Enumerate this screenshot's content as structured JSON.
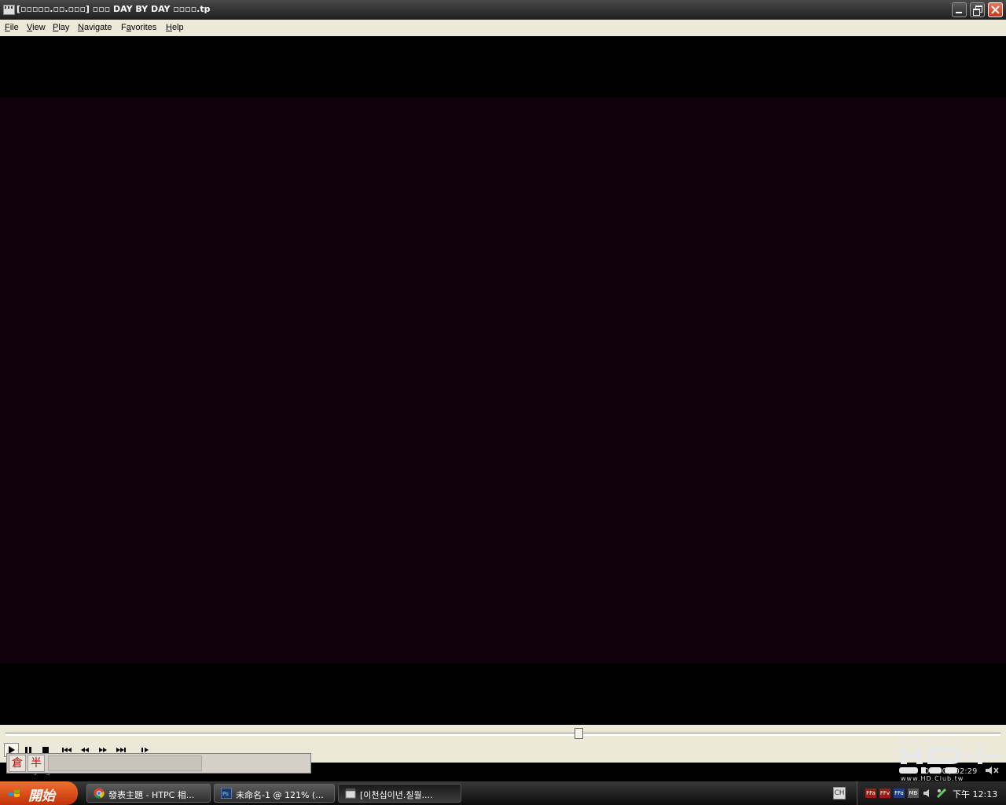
{
  "window": {
    "title": "[▫▫▫▫▫.▫▫.▫▫▫] ▫▫▫ DAY BY DAY ▫▫▫▫.tp"
  },
  "menu": [
    {
      "label": "File",
      "accel": "F",
      "rest": "ile"
    },
    {
      "label": "View",
      "accel": "V",
      "rest": "iew"
    },
    {
      "label": "Play",
      "accel": "P",
      "rest": "lay"
    },
    {
      "label": "Navigate",
      "accel": "N",
      "rest": "avigate"
    },
    {
      "label": "Favorites",
      "accel": "a",
      "pre": "F",
      "rest": "vorites"
    },
    {
      "label": "Help",
      "accel": "H",
      "rest": "elp"
    }
  ],
  "player": {
    "seek_position": 0.576,
    "status": "Playing",
    "time": "02:00 / 02:29"
  },
  "ime": {
    "key1": "倉",
    "key2": "半"
  },
  "logo": {
    "url_text": "www.HD.Club.tw"
  },
  "taskbar": {
    "start_label": "開始",
    "tasks": [
      {
        "label": "發表主題 - HTPC 相...",
        "icon": "chrome-icon"
      },
      {
        "label": "未命名-1 @ 121% (...",
        "icon": "photoshop-icon"
      },
      {
        "label": "[이천십이년.칠월....",
        "icon": "media-player-icon",
        "active": true
      }
    ],
    "lang": "CH",
    "tray_icons": [
      "FFa",
      "FFv",
      "FFa",
      "MB"
    ],
    "clock": "下午 12:13"
  },
  "colors": {
    "video_bg": "#0e000d",
    "menubar_bg": "#ece9d8",
    "start_orange": "#e0581c"
  }
}
